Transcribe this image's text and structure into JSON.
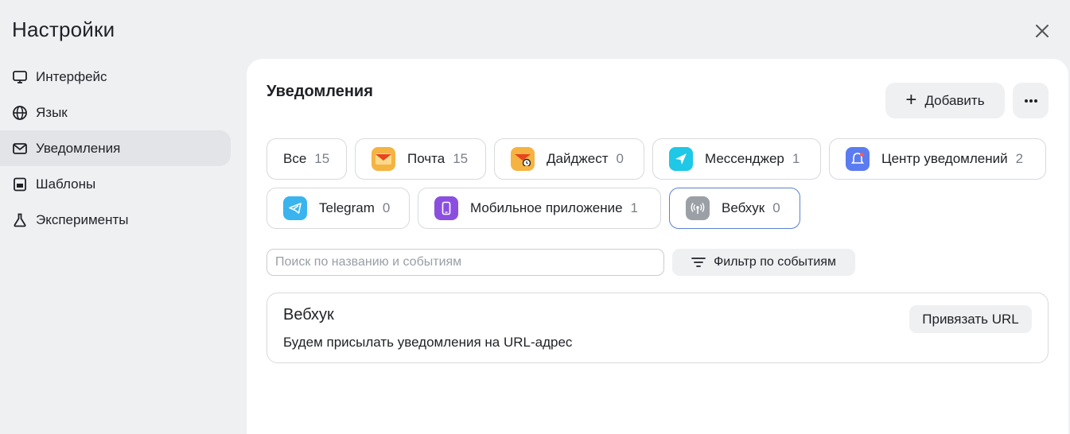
{
  "page": {
    "title": "Настройки"
  },
  "sidebar": {
    "items": [
      {
        "label": "Интерфейс",
        "icon": "monitor-icon"
      },
      {
        "label": "Язык",
        "icon": "globe-icon"
      },
      {
        "label": "Уведомления",
        "icon": "mail-icon",
        "active": true
      },
      {
        "label": "Шаблоны",
        "icon": "template-icon"
      },
      {
        "label": "Эксперименты",
        "icon": "flask-icon"
      }
    ]
  },
  "main": {
    "title": "Уведомления",
    "add_label": "Добавить",
    "channels": [
      {
        "label": "Все",
        "count": "15"
      },
      {
        "label": "Почта",
        "count": "15",
        "icon": "mail-envelope-icon",
        "color": "#f5a623"
      },
      {
        "label": "Дайджест",
        "count": "0",
        "icon": "digest-icon",
        "color": "#f5a623"
      },
      {
        "label": "Мессенджер",
        "count": "1",
        "icon": "messenger-icon",
        "color": "#1ec8e6"
      },
      {
        "label": "Центр уведомлений",
        "count": "2",
        "icon": "bell-icon",
        "color": "#5b7cf0"
      },
      {
        "label": "Telegram",
        "count": "0",
        "icon": "telegram-icon",
        "color": "#3ab4ee"
      },
      {
        "label": "Мобильное приложение",
        "count": "1",
        "icon": "phone-icon",
        "color": "#8b4fe0"
      },
      {
        "label": "Вебхук",
        "count": "0",
        "icon": "webhook-icon",
        "color": "#9aa0a6",
        "selected": true
      }
    ],
    "search": {
      "placeholder": "Поиск по названию и событиям",
      "value": ""
    },
    "filter_label": "Фильтр по событиям",
    "card": {
      "title": "Вебхук",
      "description": "Будем присылать уведомления на URL-адрес",
      "button_label": "Привязать URL"
    }
  }
}
